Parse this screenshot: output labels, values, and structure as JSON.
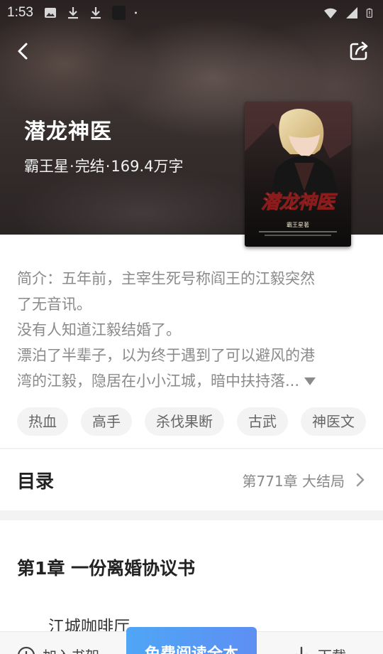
{
  "status_bar": {
    "time": "1:53",
    "icons": [
      "image-icon",
      "download-icon",
      "download-icon",
      "app-icon",
      "dot-icon"
    ],
    "right_icons": [
      "wifi-icon",
      "signal-icon",
      "battery-icon"
    ]
  },
  "nav": {
    "back_icon": "back-arrow-icon",
    "share_icon": "share-icon"
  },
  "book": {
    "title": "潜龙神医",
    "author": "霸王星",
    "status": "完结",
    "word_count": "169.4万字",
    "cover_title": "潜龙神医",
    "cover_author": "霸王星著"
  },
  "intro": {
    "line1": "简介：五年前，主宰生死号称阎王的江毅突然",
    "line2": "了无音讯。",
    "line3": "没有人知道江毅结婚了。",
    "line4": "漂泊了半辈子，以为终于遇到了可以避风的港",
    "line5": "湾的江毅，隐居在小小江城，暗中扶持落..."
  },
  "tags": [
    "热血",
    "高手",
    "杀伐果断",
    "古武",
    "神医文"
  ],
  "toc": {
    "label": "目录",
    "latest_chapter": "第771章 大结局"
  },
  "chapter": {
    "title": "第1章 一份离婚协议书",
    "first_line": "江城咖啡厅"
  },
  "bottom_bar": {
    "shelf_label": "加入书架",
    "read_label": "免费阅读全本",
    "download_label": "下载"
  },
  "colors": {
    "accent_gradient_start": "#4fa6f6",
    "accent_gradient_end": "#5d8ff3",
    "intro_text": "#8a8a8a",
    "tag_bg": "#f3f3f3"
  }
}
